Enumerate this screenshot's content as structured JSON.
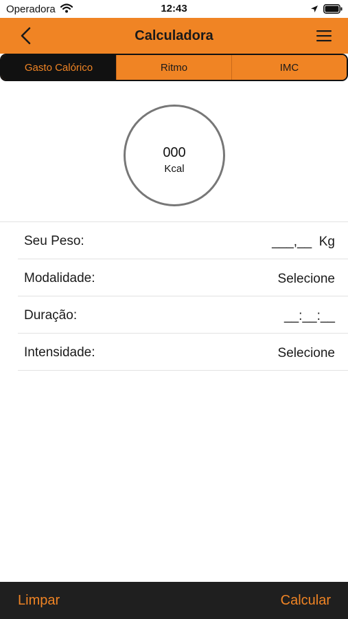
{
  "status_bar": {
    "carrier": "Operadora",
    "time": "12:43"
  },
  "nav": {
    "title": "Calculadora"
  },
  "tabs": [
    {
      "label": "Gasto Calórico",
      "active": true
    },
    {
      "label": "Ritmo",
      "active": false
    },
    {
      "label": "IMC",
      "active": false
    }
  ],
  "result": {
    "value": "000",
    "unit": "Kcal"
  },
  "form": {
    "rows": [
      {
        "label": "Seu Peso:",
        "value": "___,__  Kg"
      },
      {
        "label": "Modalidade:",
        "value": "Selecione"
      },
      {
        "label": "Duração:",
        "value": "__:__:__"
      },
      {
        "label": "Intensidade:",
        "value": "Selecione"
      }
    ]
  },
  "bottom_bar": {
    "clear_label": "Limpar",
    "calculate_label": "Calcular"
  },
  "colors": {
    "accent": "#f08424",
    "active_tab_bg": "#111111",
    "bottom_bar_bg": "#1f1f1f"
  },
  "icons": [
    "wifi-icon",
    "location-arrow-icon",
    "battery-icon",
    "chevron-left-icon",
    "hamburger-menu-icon"
  ]
}
